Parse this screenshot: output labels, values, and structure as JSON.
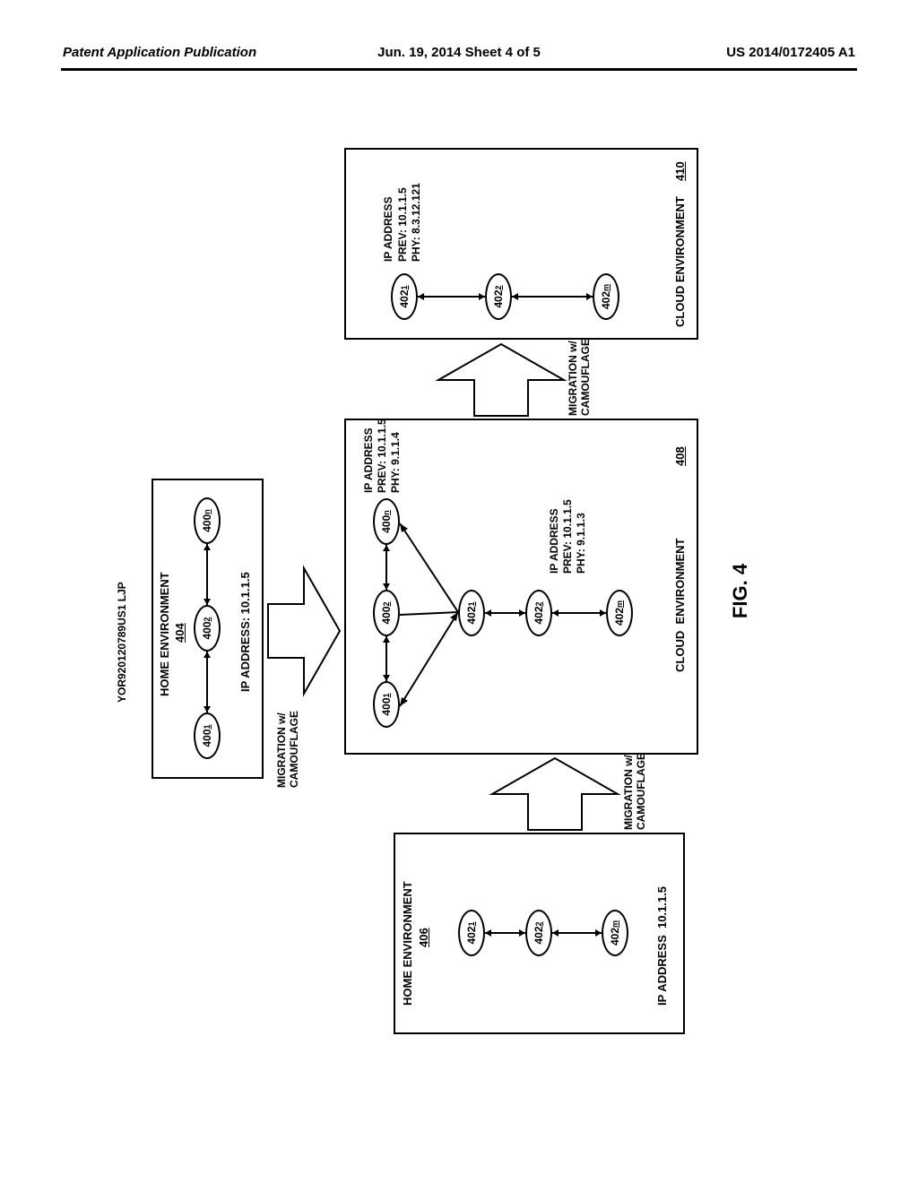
{
  "header": {
    "left": "Patent Application Publication",
    "center": "Jun. 19, 2014  Sheet 4 of 5",
    "right": "US 2014/0172405 A1"
  },
  "docnum": "YOR920120789US1 LJP",
  "figure": "FIG. 4",
  "boxes": {
    "home404": {
      "title": "HOME ENVIRONMENT",
      "ref": "404",
      "ip": "IP ADDRESS: 10.1.1.5"
    },
    "home406": {
      "title": "HOME ENVIRONMENT",
      "ref": "406",
      "ip": "IP ADDRESS  10.1.1.5"
    },
    "cloud408": {
      "title": "CLOUD  ENVIRONMENT",
      "ref": "408",
      "ip_a": "IP ADDRESS\nPREV: 10.1.1.5\nPHY: 9.1.1.4",
      "ip_b": "IP ADDRESS\nPREV: 10.1.1.5\nPHY: 9.1.1.3"
    },
    "cloud410": {
      "title": "CLOUD ENVIRONMENT",
      "ref": "410",
      "ip": "IP ADDRESS\nPREV: 10.1.1.5\nPHY: 8.3.12.121"
    }
  },
  "nodes": {
    "n400_1": "400",
    "n400_2": "400",
    "n400_n": "400",
    "n402_1": "402",
    "n402_2": "402",
    "n402_m": "402"
  },
  "subs": {
    "s1": "1",
    "s2": "2",
    "sn": "n",
    "sm": "m"
  },
  "migration": "MIGRATION w/\nCAMOUFLAGE"
}
